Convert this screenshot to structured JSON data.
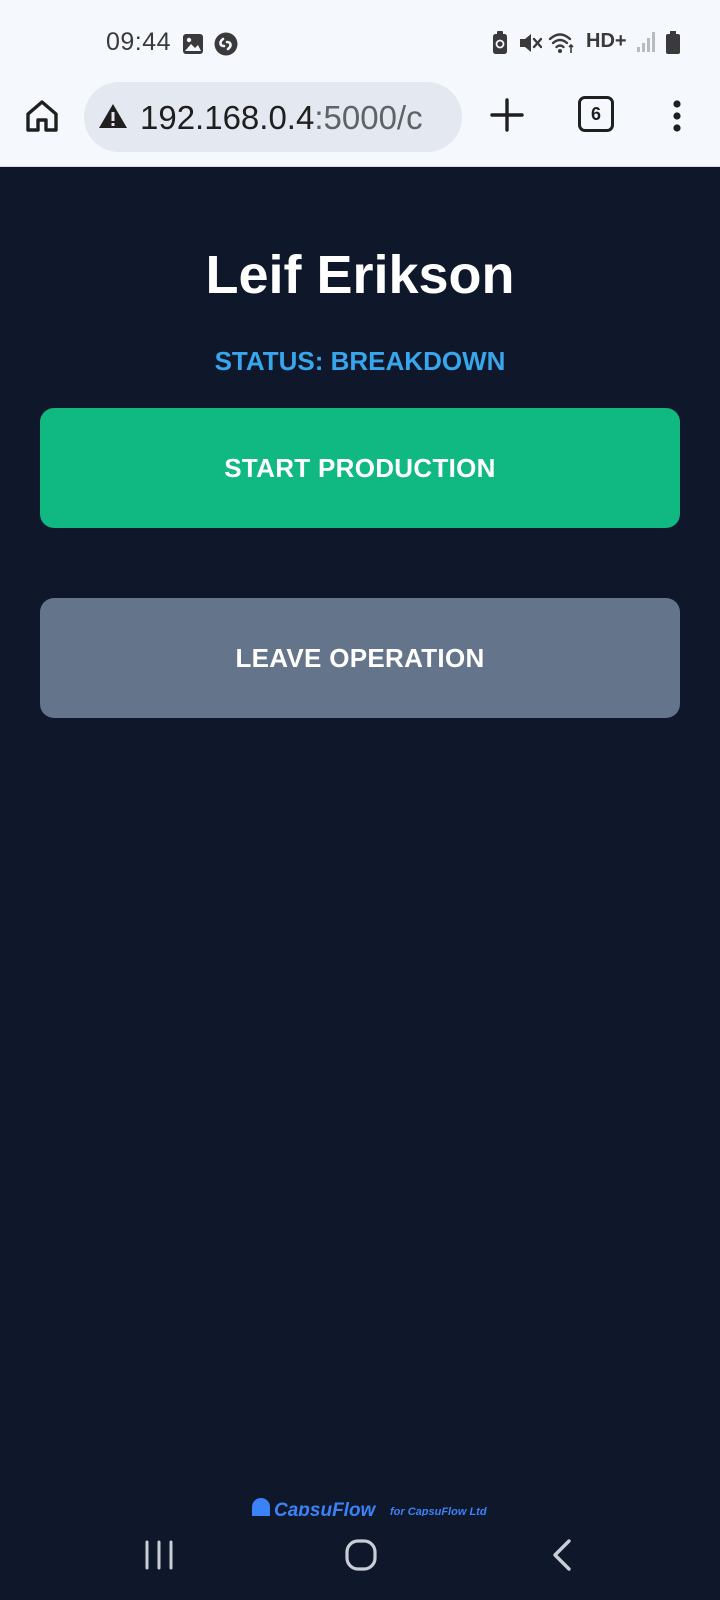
{
  "status_bar": {
    "time": "09:44",
    "network_label": "HD+"
  },
  "browser": {
    "url_host": "192.168.0.4",
    "url_rest": ":5000/c",
    "tab_count": "6"
  },
  "operator": {
    "name": "Leif Erikson",
    "status_text": "STATUS: BREAKDOWN"
  },
  "actions": {
    "start_label": "START PRODUCTION",
    "leave_label": "LEAVE OPERATION"
  },
  "footer": {
    "brand": "CapsuFlow",
    "credit": "for CapsuFlow Ltd"
  },
  "colors": {
    "background": "#0f172a",
    "status_text": "#38a6ec",
    "start_button": "#10b981",
    "leave_button": "#64748b"
  }
}
